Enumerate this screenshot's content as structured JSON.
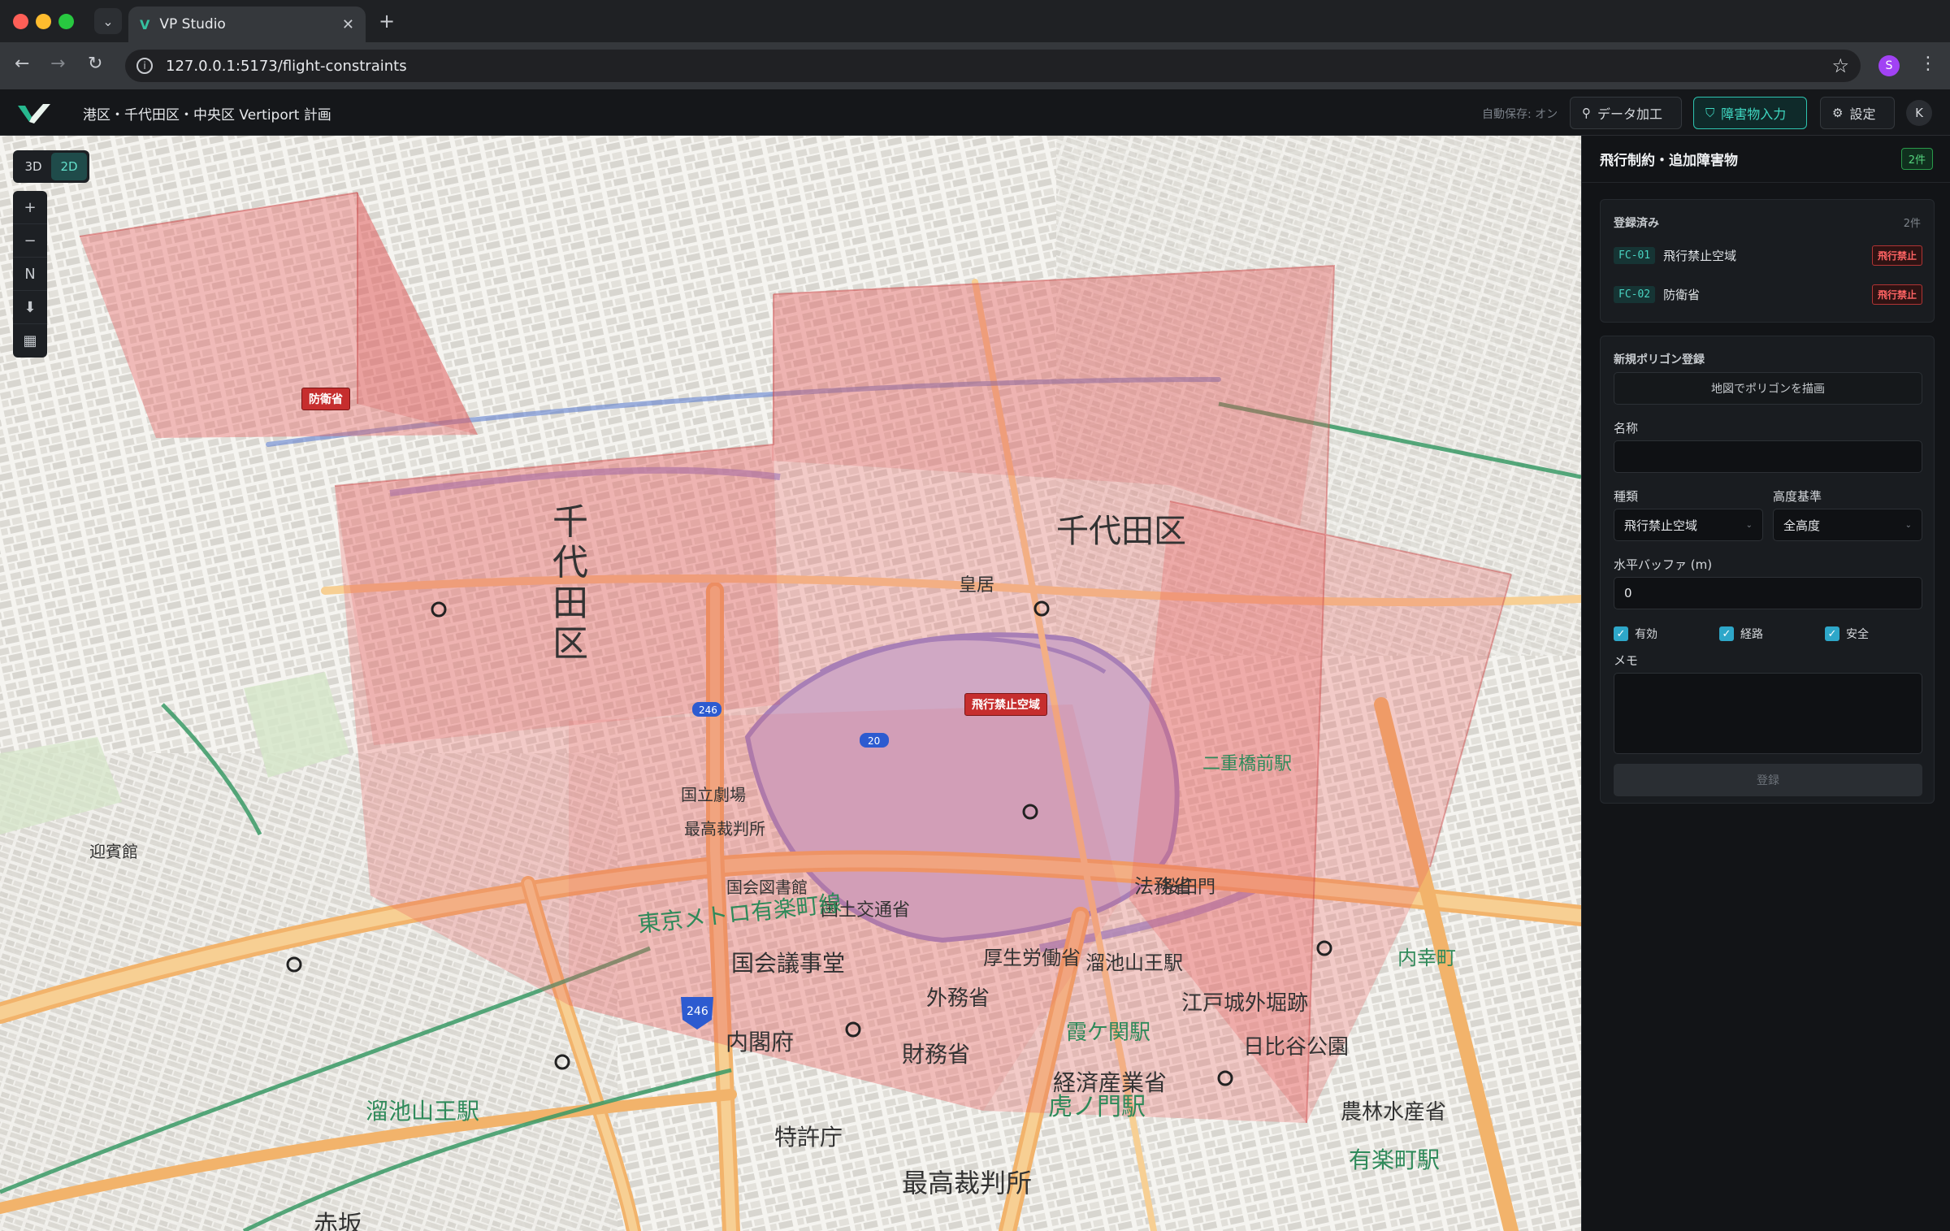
{
  "browser": {
    "tab_title": "VP Studio",
    "url": "127.0.0.1:5173/flight-constraints",
    "profile_initial": "S"
  },
  "header": {
    "project_title": "港区・千代田区・中央区 Vertiport 計画",
    "autosave": "自動保存: オン",
    "btn_data": "データ加工",
    "btn_obstacle": "障害物入力",
    "btn_settings": "設定",
    "user_initial": "K"
  },
  "map": {
    "mode_3d": "3D",
    "mode_2d": "2D",
    "ctrl_zoom_in": "+",
    "ctrl_zoom_out": "−",
    "ctrl_north": "N",
    "label_defense": "防衛省",
    "label_nofly": "飛行禁止空域",
    "place_labels": [
      "千代田区",
      "千代田区",
      "皇居",
      "国会議事堂",
      "外務省",
      "財務省",
      "内閣府",
      "特許庁",
      "経済産業省",
      "霞ケ関駅",
      "虎ノ門駅",
      "赤坂",
      "日比谷公園",
      "東京メトロ有楽町線",
      "迎賓館",
      "国立劇場",
      "最高裁判所",
      "国会図書館",
      "江戸城外堀跡",
      "溜池山王駅",
      "厚生労働省",
      "農林水産省",
      "国土交通省",
      "法務省",
      "桜田門",
      "有楽町駅",
      "内幸町",
      "二重橋前駅"
    ],
    "route_246": "246",
    "route_20": "20"
  },
  "sidebar": {
    "title": "飛行制約・追加障害物",
    "count_badge": "2件",
    "registered": {
      "title": "登録済み",
      "count": "2件",
      "items": [
        {
          "code": "FC-01",
          "name": "飛行禁止空域",
          "tag": "飛行禁止"
        },
        {
          "code": "FC-02",
          "name": "防衛省",
          "tag": "飛行禁止"
        }
      ]
    },
    "new_polygon": {
      "title": "新規ポリゴン登録",
      "draw_button": "地図でポリゴンを描画",
      "name_label": "名称",
      "name_value": "",
      "type_label": "種類",
      "type_value": "飛行禁止空域",
      "altitude_label": "高度基準",
      "altitude_value": "全高度",
      "buffer_label": "水平バッファ (m)",
      "buffer_value": "0",
      "check_enabled": "有効",
      "check_route": "経路",
      "check_safety": "安全",
      "memo_label": "メモ",
      "submit": "登録"
    }
  },
  "colors": {
    "accent": "#2ec4b0",
    "danger": "#c62e2e",
    "zone_fill": "#e85d5d"
  }
}
